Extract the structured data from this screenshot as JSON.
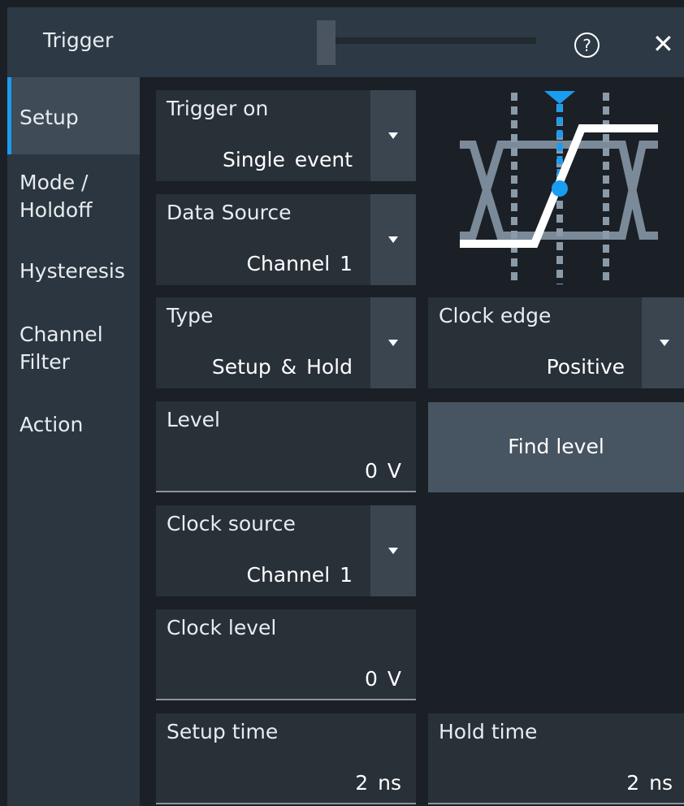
{
  "window": {
    "title": "Trigger",
    "help_icon": "help-icon",
    "close_icon": "close-icon",
    "close_glyph": "✕"
  },
  "sidebar": {
    "items": [
      {
        "label": "Setup",
        "active": true
      },
      {
        "label": "Mode /\nHoldoff",
        "active": false
      },
      {
        "label": "Hysteresis",
        "active": false
      },
      {
        "label": "Channel\nFilter",
        "active": false
      },
      {
        "label": "Action",
        "active": false
      }
    ]
  },
  "setup": {
    "trigger_on": {
      "label": "Trigger on",
      "value": "Single event"
    },
    "data_source": {
      "label": "Data Source",
      "value": "Channel 1"
    },
    "type": {
      "label": "Type",
      "value": "Setup & Hold"
    },
    "clock_edge": {
      "label": "Clock edge",
      "value": "Positive"
    },
    "level": {
      "label": "Level",
      "value": "0 V"
    },
    "find_level": "Find level",
    "clock_source": {
      "label": "Clock source",
      "value": "Channel 1"
    },
    "clock_level": {
      "label": "Clock level",
      "value": "0 V"
    },
    "setup_time": {
      "label": "Setup time",
      "value": "2 ns"
    },
    "hold_time": {
      "label": "Hold time",
      "value": "2 ns"
    }
  },
  "colors": {
    "accent": "#1a9cf0",
    "panel": "#283038",
    "title_bar": "#2d3945",
    "sidebar": "#2b3640"
  }
}
